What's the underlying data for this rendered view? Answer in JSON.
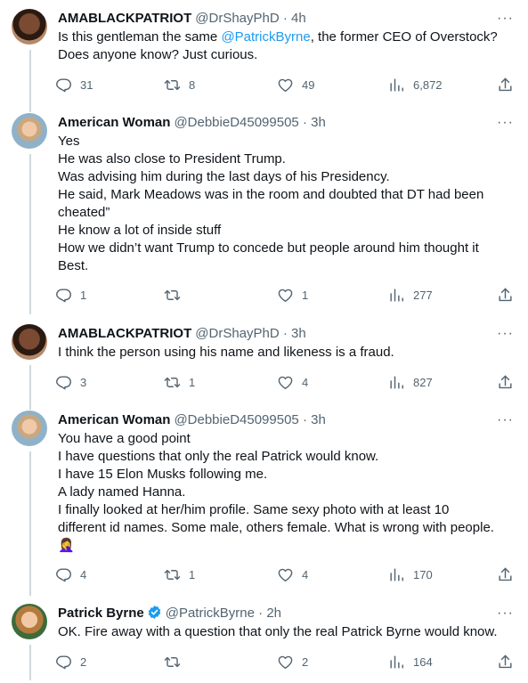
{
  "tweets": [
    {
      "name": "AMABLACKPATRIOT",
      "handle": "@DrShayPhD",
      "time": "· 4h",
      "text_before_mention": "Is this gentleman the same ",
      "mention": "@PatrickByrne",
      "text_after_mention": ", the former CEO of Overstock?",
      "line2": "Does anyone know? Just curious.",
      "replies": "31",
      "retweets": "8",
      "likes": "49",
      "views": "6,872"
    },
    {
      "name": "American Woman",
      "handle": "@DebbieD45099505",
      "time": "· 3h",
      "lines": [
        "Yes",
        "He was also close to President Trump.",
        "Was advising him during the last days of his Presidency.",
        "He said, Mark Meadows was in the room and doubted that DT had been",
        "cheated”",
        "He know a lot of inside stuff",
        "How we didn’t want Trump to concede but people around him thought it",
        "Best."
      ],
      "replies": "1",
      "retweets": "",
      "likes": "1",
      "views": "277"
    },
    {
      "name": "AMABLACKPATRIOT",
      "handle": "@DrShayPhD",
      "time": "· 3h",
      "lines": [
        "I think the person using his name and likeness is a fraud."
      ],
      "replies": "3",
      "retweets": "1",
      "likes": "4",
      "views": "827"
    },
    {
      "name": "American Woman",
      "handle": "@DebbieD45099505",
      "time": "· 3h",
      "lines": [
        "You have a good point",
        "I have questions that only the real Patrick would know.",
        "I have 15 Elon Musks following me.",
        "A lady named Hanna.",
        "I finally looked at her/him profile. Same sexy photo with at least 10",
        "different id names. Some male, others female. What is wrong with people.",
        "🤦‍♀️"
      ],
      "replies": "4",
      "retweets": "1",
      "likes": "4",
      "views": "170"
    },
    {
      "name": "Patrick Byrne",
      "handle": "@PatrickByrne",
      "time": "· 2h",
      "lines": [
        "OK. Fire away with a question that only the real Patrick Byrne would know."
      ],
      "replies": "2",
      "retweets": "",
      "likes": "2",
      "views": "164"
    }
  ],
  "more_glyph": "···",
  "colors": {
    "text": "#0f1419",
    "secondary": "#536471",
    "link": "#1d9bf0",
    "thread": "#cfd9de",
    "verified": "#1d9bf0"
  },
  "icons": [
    "reply-icon",
    "retweet-icon",
    "like-icon",
    "views-icon",
    "share-icon",
    "more-icon",
    "verified-badge-icon"
  ]
}
